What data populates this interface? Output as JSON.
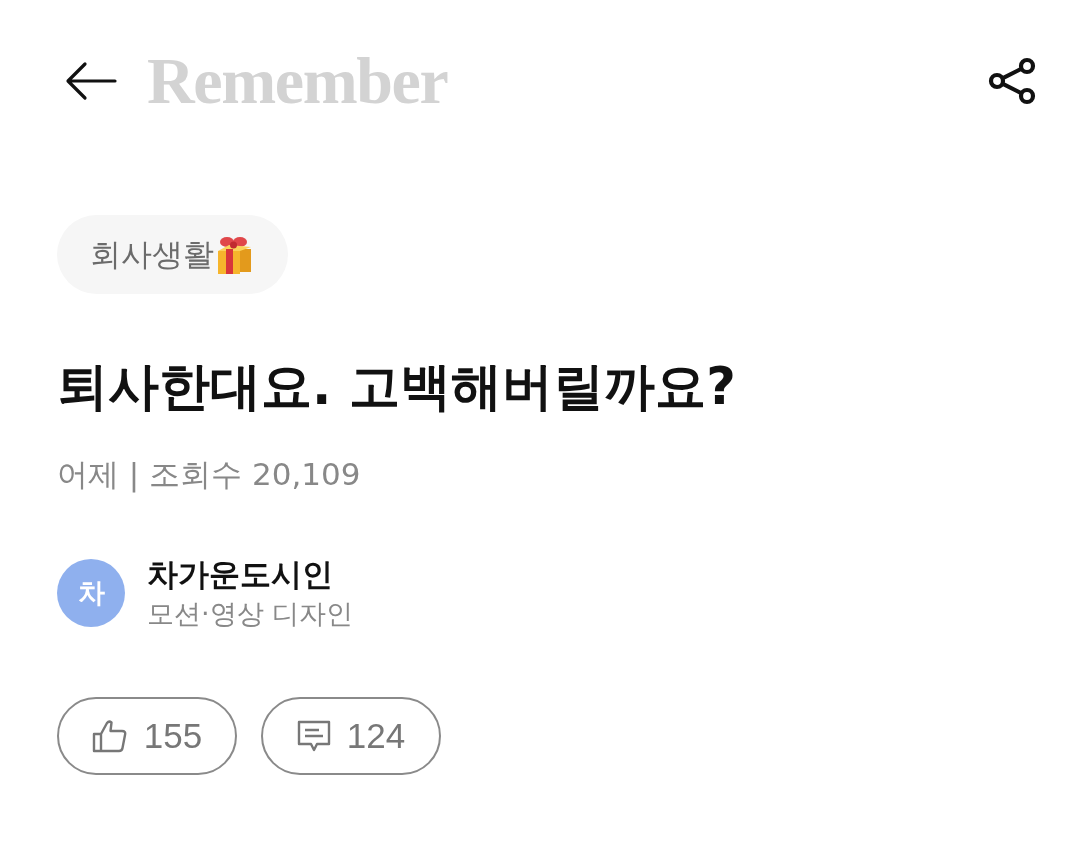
{
  "header": {
    "logo": "Remember"
  },
  "category": {
    "label": "회사생활"
  },
  "post": {
    "title": "퇴사한대요. 고백해버릴까요?",
    "meta": "어제 | 조회수 20,109"
  },
  "author": {
    "initial": "차",
    "name": "차가운도시인",
    "role": "모션·영상 디자인"
  },
  "reactions": [
    {
      "kind": "like",
      "count": "155"
    },
    {
      "kind": "comment",
      "count": "124"
    }
  ]
}
